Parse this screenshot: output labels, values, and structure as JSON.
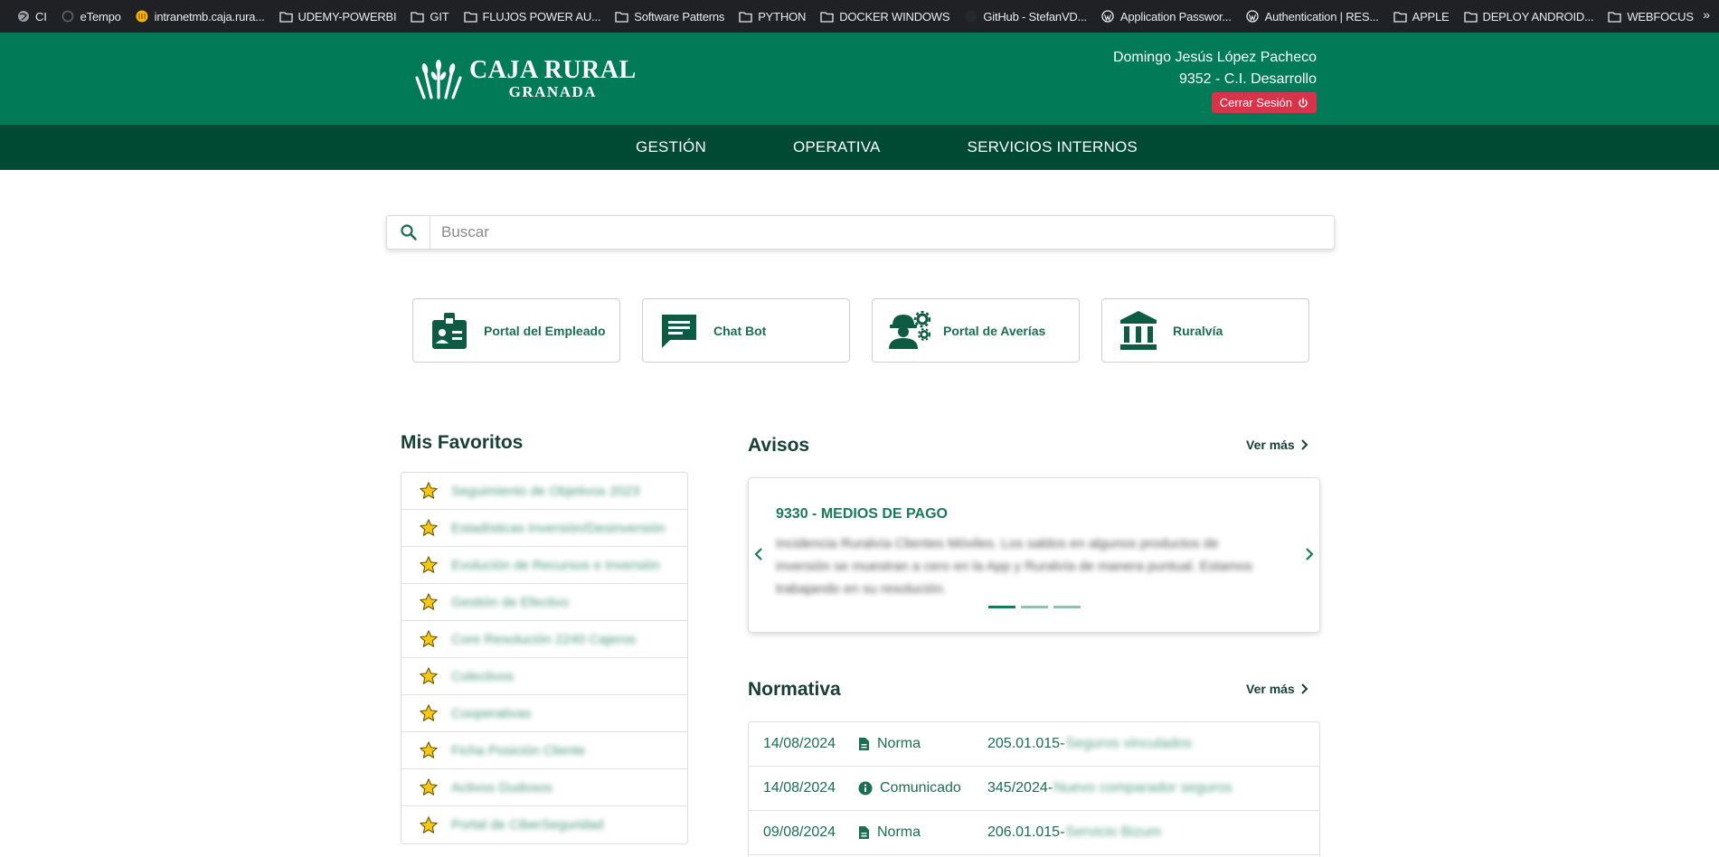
{
  "bookmarks": [
    {
      "label": "CI",
      "icon": "globe-icon"
    },
    {
      "label": "eTempo",
      "icon": "etempo-icon"
    },
    {
      "label": "intranetmb.caja.rura...",
      "icon": "site-icon"
    },
    {
      "label": "UDEMY-POWERBI",
      "icon": "folder-icon"
    },
    {
      "label": "GIT",
      "icon": "folder-icon"
    },
    {
      "label": "FLUJOS POWER AU...",
      "icon": "folder-icon"
    },
    {
      "label": "Software Patterns",
      "icon": "folder-icon"
    },
    {
      "label": "PYTHON",
      "icon": "folder-icon"
    },
    {
      "label": "DOCKER WINDOWS",
      "icon": "folder-icon"
    },
    {
      "label": "GitHub - StefanVD...",
      "icon": "github-icon"
    },
    {
      "label": "Application Passwor...",
      "icon": "wordpress-icon"
    },
    {
      "label": "Authentication | RES...",
      "icon": "wordpress-icon"
    },
    {
      "label": "APPLE",
      "icon": "folder-icon"
    },
    {
      "label": "DEPLOY ANDROID...",
      "icon": "folder-icon"
    },
    {
      "label": "WEBFOCUS",
      "icon": "folder-icon"
    }
  ],
  "brand": {
    "line1": "CAJA RURAL",
    "line2": "GRANADA",
    "primary_color": "#007a57",
    "dark_color": "#004a34",
    "logout_color": "#d9334b"
  },
  "user": {
    "name": "Domingo Jesús López Pacheco",
    "center": "9352 - C.I. Desarrollo",
    "logout_label": "Cerrar Sesión"
  },
  "nav": [
    "GESTIÓN",
    "OPERATIVA",
    "SERVICIOS INTERNOS"
  ],
  "search": {
    "placeholder": "Buscar"
  },
  "quick_links": [
    {
      "label": "Portal del Empleado",
      "icon": "employee-badge-icon"
    },
    {
      "label": "Chat Bot",
      "icon": "chat-icon"
    },
    {
      "label": "Portal de Averías",
      "icon": "technician-gear-icon"
    },
    {
      "label": "Ruralvía",
      "icon": "bank-icon"
    }
  ],
  "favorites": {
    "title": "Mis Favoritos",
    "items": [
      "Seguimiento de Objetivos 2023",
      "Estadísticas Inversión/Desinversión",
      "Evolución de Recursos e Inversión",
      "Gestión de Efectivo",
      "Core Resolución 2240 Cajeros",
      "Colectivos",
      "Cooperativas",
      "Ficha Posición Cliente",
      "Activos Dudosos",
      "Portal de CiberSeguridad"
    ]
  },
  "avisos": {
    "title": "Avisos",
    "ver_mas": "Ver más",
    "card_title": "9330 - MEDIOS DE PAGO",
    "card_body": "Incidencia Ruralvía Clientes Móviles. Los saldos en algunos productos de inversión se muestran a cero en la App y Ruralvía de manera puntual. Estamos trabajando en su resolución."
  },
  "normativa": {
    "title": "Normativa",
    "ver_mas": "Ver más",
    "rows": [
      {
        "date": "14/08/2024",
        "type": "Norma",
        "icon": "document-icon",
        "ref": "205.01.015-",
        "desc": "Seguros vinculados"
      },
      {
        "date": "14/08/2024",
        "type": "Comunicado",
        "icon": "info-icon",
        "ref": "345/2024-",
        "desc": "Nuevo comparador seguros"
      },
      {
        "date": "09/08/2024",
        "type": "Norma",
        "icon": "document-icon",
        "ref": "206.01.015-",
        "desc": "Servicio Bizum"
      }
    ]
  }
}
